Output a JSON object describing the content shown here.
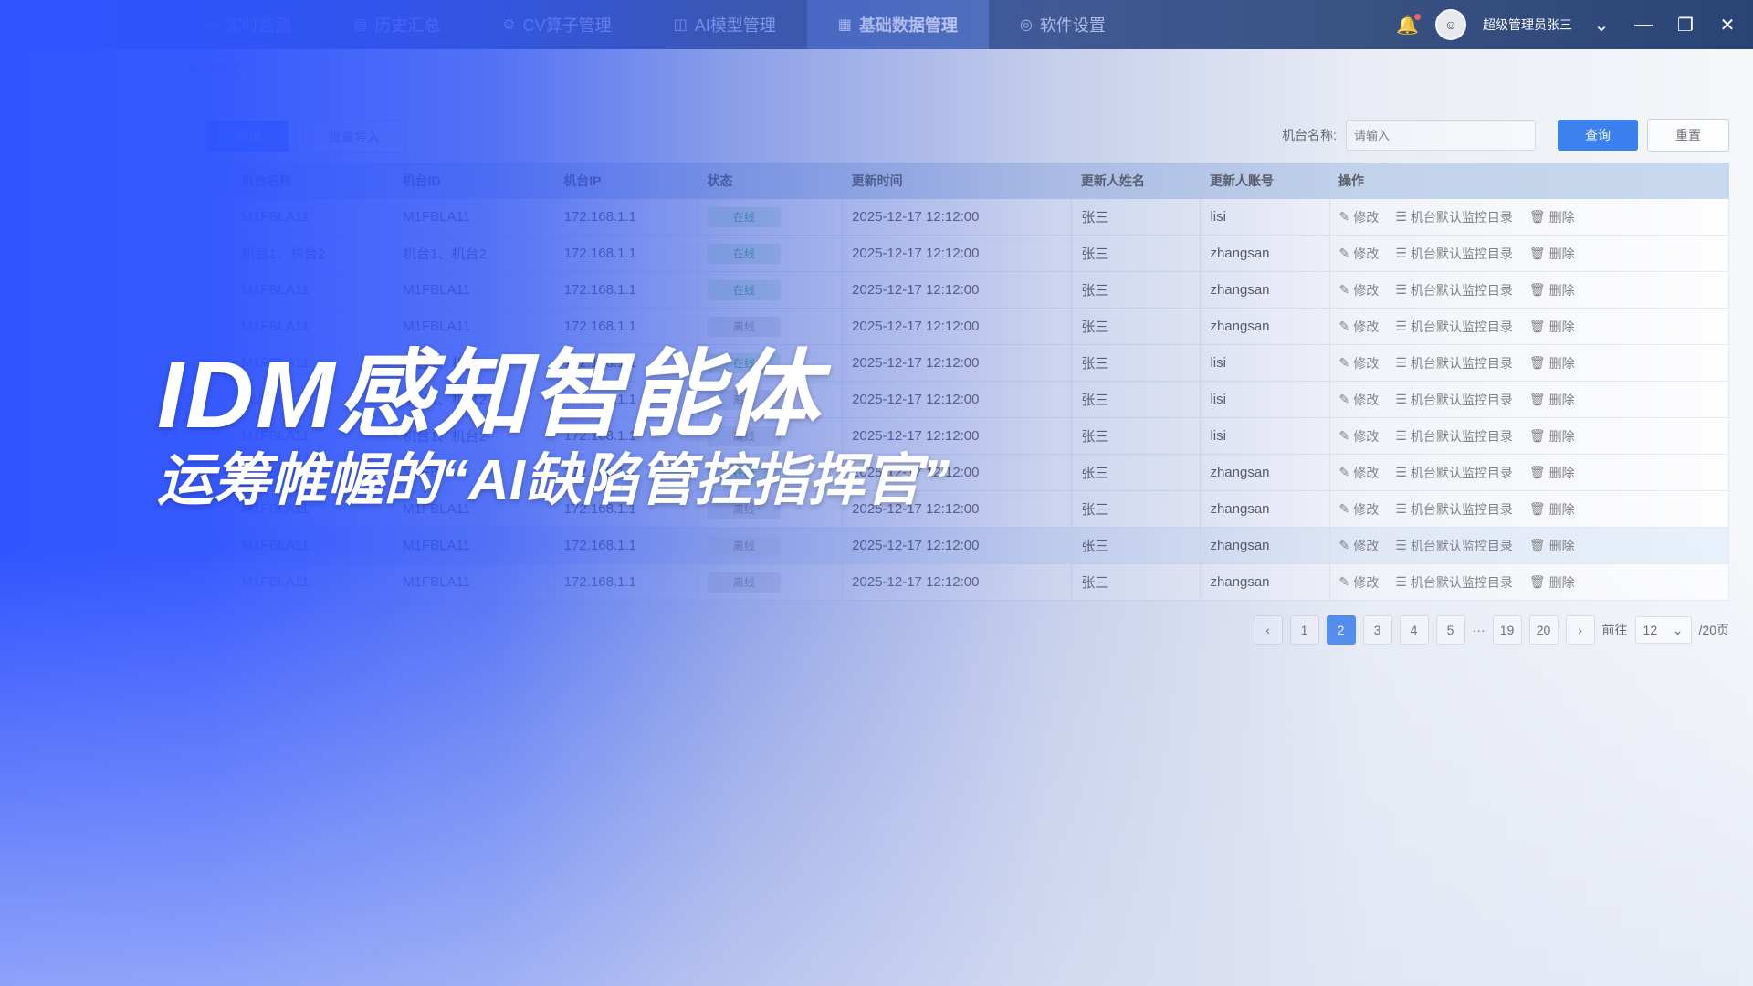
{
  "nav": {
    "tabs": [
      {
        "label": "实时监测",
        "icon": "monitor-icon",
        "active": false
      },
      {
        "label": "历史汇总",
        "icon": "history-icon",
        "active": false
      },
      {
        "label": "CV算子管理",
        "icon": "operator-icon",
        "active": false
      },
      {
        "label": "AI模型管理",
        "icon": "model-icon",
        "active": false
      },
      {
        "label": "基础数据管理",
        "icon": "database-icon",
        "active": true
      },
      {
        "label": "软件设置",
        "icon": "settings-icon",
        "active": false
      }
    ],
    "user_name": "超级管理员张三"
  },
  "breadcrumb": "机台管理",
  "toolbar": {
    "add_label": "新增",
    "import_label": "批量导入"
  },
  "search": {
    "label": "机台名称:",
    "placeholder": "请输入",
    "query_label": "查询",
    "reset_label": "重置"
  },
  "table": {
    "headers": [
      "机台名称",
      "机台ID",
      "机台IP",
      "状态",
      "更新时间",
      "更新人姓名",
      "更新人账号",
      "操作"
    ],
    "op_labels": {
      "edit": "修改",
      "monitor": "机台默认监控目录",
      "delete": "删除"
    },
    "rows": [
      {
        "name": "M1FBLA11",
        "id": "M1FBLA11",
        "ip": "172.168.1.1",
        "status": "在线",
        "status_type": "on",
        "time": "2025-12-17  12:12:00",
        "user_name": "张三",
        "account": "lisi"
      },
      {
        "name": "机台1、机台2",
        "id": "机台1、机台2",
        "ip": "172.168.1.1",
        "status": "在线",
        "status_type": "on",
        "time": "2025-12-17  12:12:00",
        "user_name": "张三",
        "account": "zhangsan"
      },
      {
        "name": "M1FBLA11",
        "id": "M1FBLA11",
        "ip": "172.168.1.1",
        "status": "在线",
        "status_type": "on",
        "time": "2025-12-17  12:12:00",
        "user_name": "张三",
        "account": "zhangsan"
      },
      {
        "name": "M1FBLA11",
        "id": "M1FBLA11",
        "ip": "172.168.1.1",
        "status": "离线",
        "status_type": "off",
        "time": "2025-12-17  12:12:00",
        "user_name": "张三",
        "account": "zhangsan"
      },
      {
        "name": "M1FBLA11",
        "id": "机台1、机台2",
        "ip": "172.168.1.1",
        "status": "在线",
        "status_type": "on",
        "time": "2025-12-17  12:12:00",
        "user_name": "张三",
        "account": "lisi"
      },
      {
        "name": "M1FBLA11",
        "id": "机台1、机台2",
        "ip": "172.168.1.1",
        "status": "离线",
        "status_type": "off",
        "time": "2025-12-17  12:12:00",
        "user_name": "张三",
        "account": "lisi"
      },
      {
        "name": "M1FBLA11",
        "id": "机台1、机台2",
        "ip": "172.168.1.1",
        "status": "离线",
        "status_type": "off",
        "time": "2025-12-17  12:12:00",
        "user_name": "张三",
        "account": "lisi"
      },
      {
        "name": "M1FBLA11",
        "id": "M1FBLA11",
        "ip": "172.168.1.1",
        "status": "在线",
        "status_type": "on",
        "time": "2025-12-17  12:12:00",
        "user_name": "张三",
        "account": "zhangsan"
      },
      {
        "name": "M1FBLA11",
        "id": "M1FBLA11",
        "ip": "172.168.1.1",
        "status": "离线",
        "status_type": "off",
        "time": "2025-12-17  12:12:00",
        "user_name": "张三",
        "account": "zhangsan"
      },
      {
        "name": "M1FBLA11",
        "id": "M1FBLA11",
        "ip": "172.168.1.1",
        "status": "离线",
        "status_type": "off",
        "time": "2025-12-17  12:12:00",
        "user_name": "张三",
        "account": "zhangsan"
      },
      {
        "name": "M1FBLA11",
        "id": "M1FBLA11",
        "ip": "172.168.1.1",
        "status": "离线",
        "status_type": "off",
        "time": "2025-12-17  12:12:00",
        "user_name": "张三",
        "account": "zhangsan"
      }
    ],
    "highlight_row": 9
  },
  "pagination": {
    "pages": [
      "1",
      "2",
      "3",
      "4",
      "5",
      "···",
      "19",
      "20"
    ],
    "current": "2",
    "goto_label": "前往",
    "goto_value": "12",
    "total_label": "/20页"
  },
  "headline": {
    "title": "IDM感知智能体",
    "subtitle": "运筹帷幄的“AI缺陷管控指挥官”"
  },
  "colors": {
    "overlay_blue": "#3054ff",
    "nav_bg": "#1f3a6e",
    "accent": "#2b78f0"
  }
}
